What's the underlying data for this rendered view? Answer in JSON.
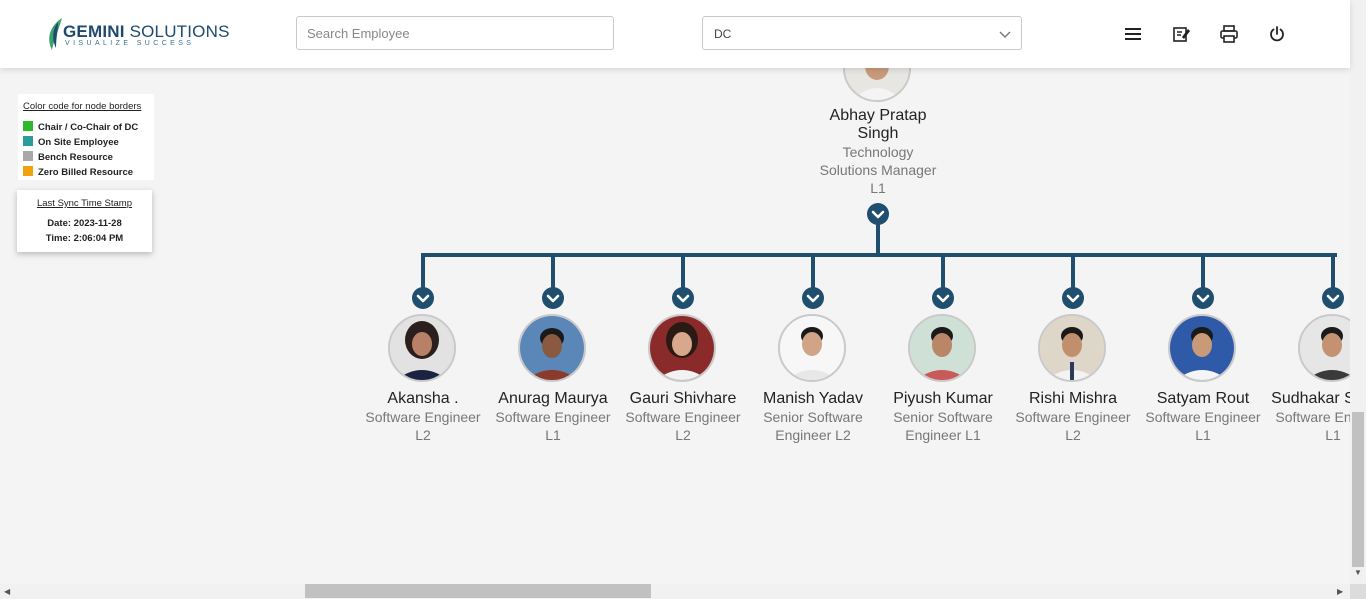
{
  "header": {
    "logo": {
      "brand_bold": "GEMINI",
      "brand_rest": " SOLUTIONS",
      "tagline": "VISUALIZE SUCCESS"
    },
    "search": {
      "placeholder": "Search Employee",
      "value": ""
    },
    "dc_select": {
      "value": "DC"
    },
    "icons": [
      "menu-icon",
      "edit-note-icon",
      "print-icon",
      "power-icon"
    ]
  },
  "legend": {
    "title": "Color code for node borders",
    "items": [
      {
        "label": "Chair / Co-Chair of DC",
        "color": "#2db82d"
      },
      {
        "label": "On Site Employee",
        "color": "#2a9d9a"
      },
      {
        "label": "Bench Resource",
        "color": "#a9a9a9"
      },
      {
        "label": "Zero Billed Resource",
        "color": "#f2a20c"
      }
    ]
  },
  "sync": {
    "title": "Last Sync Time Stamp",
    "date": "Date: 2023-11-28",
    "time": "Time: 2:06:04 PM"
  },
  "manager": {
    "name_line1": "Abhay Pratap",
    "name_line2": "Singh",
    "title_line1": "Technology",
    "title_line2": "Solutions Manager",
    "level": "L1"
  },
  "reports": [
    {
      "name": "Akansha .",
      "title_line1": "Software Engineer",
      "title_line2": "L2",
      "title_line3": ""
    },
    {
      "name": "Anurag Maurya",
      "title_line1": "Software Engineer",
      "title_line2": "L1",
      "title_line3": ""
    },
    {
      "name": "Gauri Shivhare",
      "title_line1": "Software Engineer",
      "title_line2": "L2",
      "title_line3": ""
    },
    {
      "name": "Manish Yadav",
      "title_line1": "Senior Software",
      "title_line2": "Engineer L2",
      "title_line3": ""
    },
    {
      "name": "Piyush Kumar",
      "title_line1": "Senior Software",
      "title_line2": "Engineer L1",
      "title_line3": ""
    },
    {
      "name": "Rishi Mishra",
      "title_line1": "Software Engineer",
      "title_line2": "L2",
      "title_line3": ""
    },
    {
      "name": "Satyam Rout",
      "title_line1": "Software Engineer",
      "title_line2": "L1",
      "title_line3": ""
    },
    {
      "name": "Sudhakar Sonkar",
      "title_line1": "Software Engineer",
      "title_line2": "L1",
      "title_line3": ""
    }
  ],
  "colors": {
    "tree_line": "#1f4e6f",
    "accent": "#1d4a6e"
  }
}
